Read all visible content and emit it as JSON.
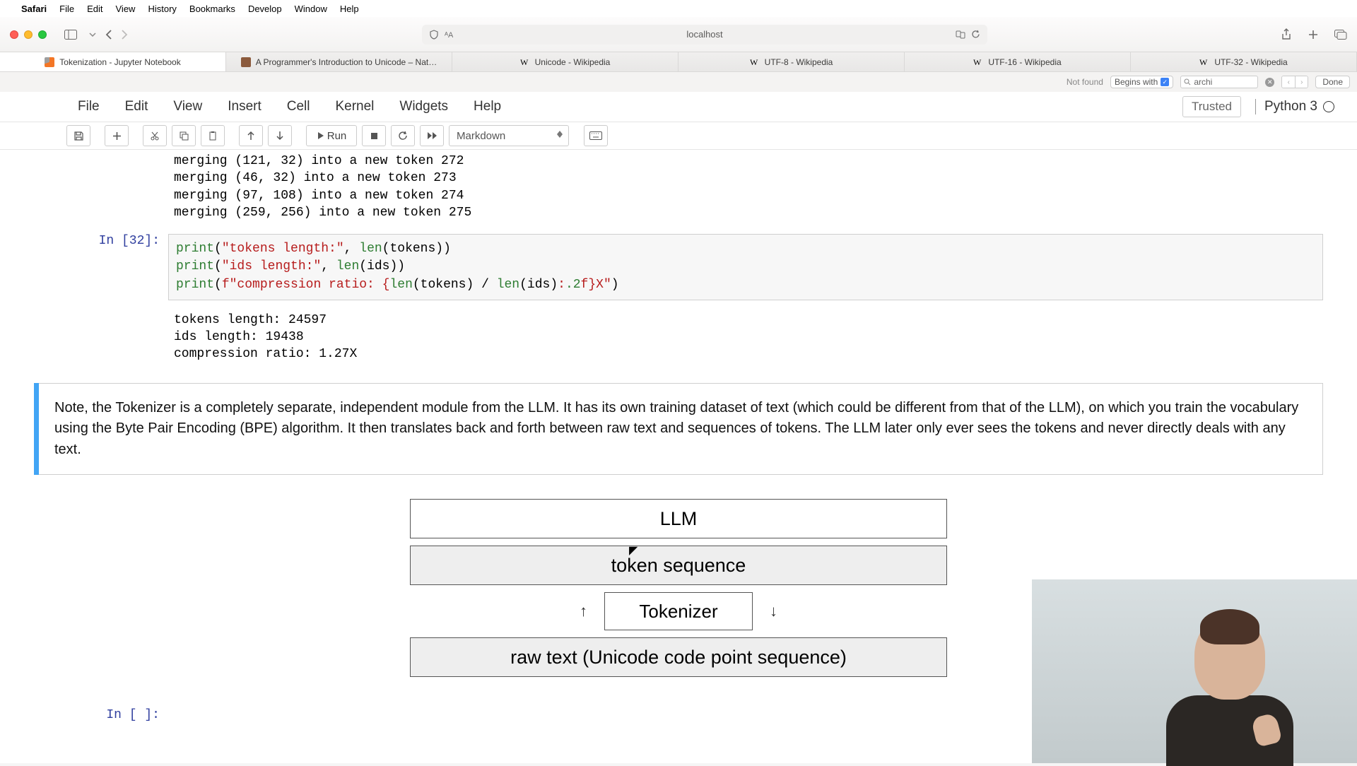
{
  "mac_menu": {
    "app": "Safari",
    "items": [
      "File",
      "Edit",
      "View",
      "History",
      "Bookmarks",
      "Develop",
      "Window",
      "Help"
    ]
  },
  "safari": {
    "url": "localhost",
    "tabs": [
      "Tokenization - Jupyter Notebook",
      "A Programmer's Introduction to Unicode – Nat…",
      "Unicode - Wikipedia",
      "UTF-8 - Wikipedia",
      "UTF-16 - Wikipedia",
      "UTF-32 - Wikipedia"
    ]
  },
  "findbar": {
    "not_found": "Not found",
    "mode": "Begins with",
    "query": "archi",
    "done": "Done"
  },
  "jupyter": {
    "menus": [
      "File",
      "Edit",
      "View",
      "Insert",
      "Cell",
      "Kernel",
      "Widgets",
      "Help"
    ],
    "trusted": "Trusted",
    "kernel": "Python 3",
    "cell_type": "Markdown",
    "run": "Run"
  },
  "notebook": {
    "out_prev": "merging (121, 32) into a new token 272\nmerging (46, 32) into a new token 273\nmerging (97, 108) into a new token 274\nmerging (259, 256) into a new token 275",
    "in_prompt": "In [32]:",
    "out_result": "tokens length: 24597\nids length: 19438\ncompression ratio: 1.27X",
    "md": "Note, the Tokenizer is a completely separate, independent module from the LLM. It has its own training dataset of text (which could be different from that of the LLM), on which you train the vocabulary using the Byte Pair Encoding (BPE) algorithm. It then translates back and forth between raw text and sequences of tokens. The LLM later only ever sees the tokens and never directly deals with any text.",
    "diagram": {
      "llm": "LLM",
      "tokens": "token sequence",
      "tokenizer": "Tokenizer",
      "raw": "raw text (Unicode code point sequence)"
    },
    "empty_prompt": "In [ ]:"
  }
}
